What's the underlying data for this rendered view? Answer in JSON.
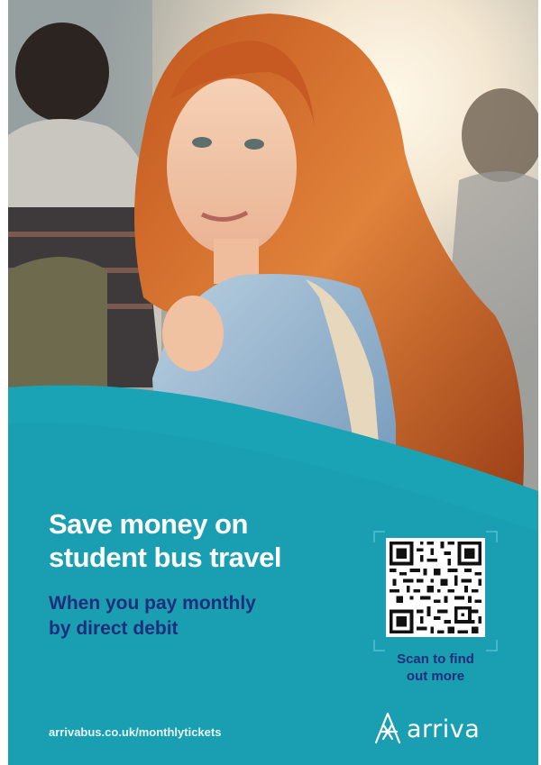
{
  "headline": {
    "line1": "Save money on",
    "line2": "student bus travel"
  },
  "subhead": {
    "line1": "When you pay monthly",
    "line2": "by direct debit"
  },
  "qr": {
    "caption_line1": "Scan to find",
    "caption_line2": "out more"
  },
  "footer": {
    "url": "arrivabus.co.uk/monthlytickets"
  },
  "logo": {
    "name": "arriva"
  },
  "colors": {
    "teal": "#1aa3b5",
    "navy": "#1f2e7a",
    "white": "#ffffff"
  }
}
